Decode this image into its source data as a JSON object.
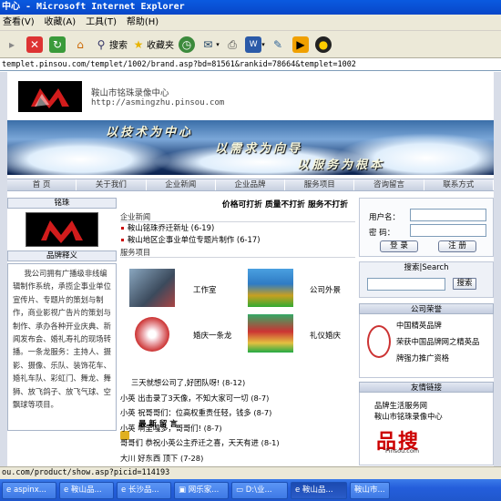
{
  "window": {
    "title": "中心 - Microsoft Internet Explorer"
  },
  "menu": {
    "items": [
      "查看(V)",
      "收藏(A)",
      "工具(T)",
      "帮助(H)"
    ]
  },
  "toolbar": {
    "search_label": "搜索",
    "favorites_label": "收藏夹"
  },
  "address": {
    "url": "templet.pinsou.com/templet/1002/brand.asp?bd=81561&rankid=78664&templet=1002"
  },
  "site": {
    "name": "鞍山市铭珠录像中心",
    "url": "http://asmingzhu.pinsou.com",
    "banner_slogans": [
      "以技术为中心",
      "以需求为向导",
      "以服务为根本"
    ]
  },
  "nav": {
    "items": [
      "首 页",
      "关于我们",
      "企业新闻",
      "企业品牌",
      "服务项目",
      "咨询留言",
      "联系方式"
    ]
  },
  "left": {
    "brand_header": "铭珠",
    "intro_header": "品牌释义",
    "intro_text": "我公司拥有广播级非线编辑制作系统，承揽企事业单位宣传片、专题片的策划与制作，商业影视广告片的策划与制作、承办各种开业庆典、新闻发布会、婚礼寿礼的现场转播。一条龙服务：主持人、摄影、摄像、乐队、装饰花车、婚礼车队、彩虹门、舞龙、舞狮、放飞鸽子、放飞气球、空飘球等项目。"
  },
  "main": {
    "headline": "价格可打折  质量不打折  服务不打折",
    "news_header": "企业新闻",
    "news": [
      {
        "text": "鞍山铭珠乔迁新址",
        "date": "(6-19)"
      },
      {
        "text": "鞍山地区企事业单位专题片制作",
        "date": "(6-17)"
      }
    ],
    "services_header": "服务项目",
    "services": [
      "工作室",
      "公司外景",
      "婚庆一条龙",
      "礼仪婚庆"
    ],
    "messages_header": "最 新 留 言",
    "messages": [
      {
        "text": "三天就想公司了,好团队呀!",
        "date": "(8-12)"
      },
      {
        "text": "小英 出击录了3天像，不知大家可一切",
        "date": "(8-7)"
      },
      {
        "text": "小英 祝哥哥们：位高权重责任轻，钱多",
        "date": "(8-7)"
      },
      {
        "text": "小英 啊里嘎多，哥哥们!",
        "date": "(8-7)"
      },
      {
        "text": "哥哥们 恭祝小英公主乔迁之喜，天天有进",
        "date": "(8-1)"
      },
      {
        "text": "大川 好东西 顶下",
        "date": "(7-28)"
      }
    ]
  },
  "right": {
    "username_label": "用户名：",
    "password_label": "密  码：",
    "login_button": "登 录",
    "register_button": "注 册",
    "search_header": "搜索|Search",
    "search_button": "搜索",
    "honor_header": "公司荣誉",
    "honor_lines": [
      "中国精英品牌",
      "荣获中国品牌网之精英品",
      "牌强力推广资格"
    ],
    "links_header": "友情链接",
    "links_lines": [
      "品牌生活服务网",
      "鞍山市铭珠录像中心"
    ],
    "pinsou_text": "品搜",
    "pinsou_sub": "Pinsou.com"
  },
  "status": {
    "text": "ou.com/product/show.asp?picid=114193"
  },
  "taskbar": {
    "items": [
      "aspinx...",
      "鞍山品...",
      "长沙品...",
      "网乐家...",
      "D:\\业...",
      "鞍山品...",
      "鞍山市..."
    ]
  },
  "colors": {
    "accent_red": "#cc0000",
    "banner_blue": "#1d3f74",
    "xp_blue": "#245edb"
  }
}
